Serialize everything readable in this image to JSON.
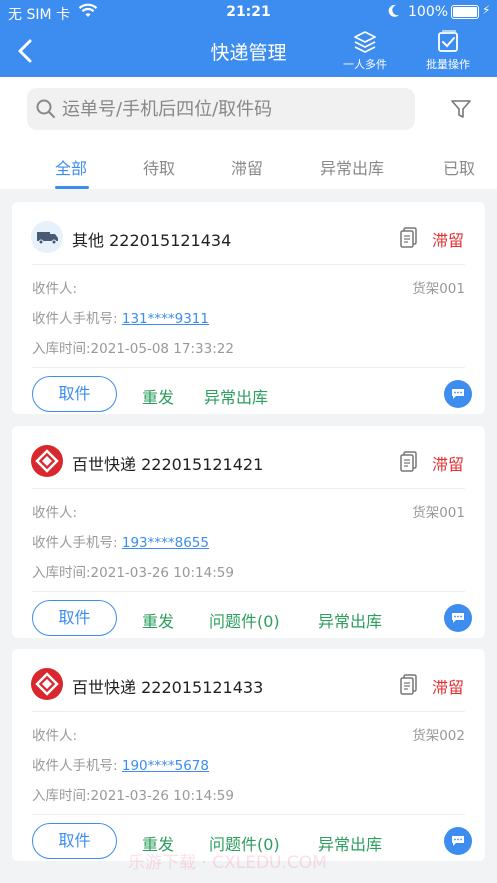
{
  "status_bar": {
    "carrier": "无 SIM 卡",
    "time": "21:21",
    "battery": "100%"
  },
  "header": {
    "title": "快递管理",
    "multi_label": "一人多件",
    "batch_label": "批量操作"
  },
  "search": {
    "placeholder": "运单号/手机后四位/取件码"
  },
  "tabs": [
    {
      "label": "全部",
      "active": true
    },
    {
      "label": "待取"
    },
    {
      "label": "滞留"
    },
    {
      "label": "异常出库"
    },
    {
      "label": "已取"
    }
  ],
  "colors": {
    "accent": "#3d8cf0",
    "status_red": "#e03131",
    "action_green": "#2c9e5e"
  },
  "packages": [
    {
      "logo_icon": "truck-icon",
      "courier": "其他",
      "tracking": "222015121434",
      "status": "滞留",
      "recipient_label": "收件人:",
      "shelf": "货架001",
      "phone_label": "收件人手机号:",
      "phone": "131****9311",
      "time": "入库时间:2021-05-08 17:33:22",
      "pickup": "取件",
      "resend": "重发",
      "abnormal": "异常出库"
    },
    {
      "logo_icon": "baishi-logo-icon",
      "courier": "百世快递",
      "tracking": "222015121421",
      "status": "滞留",
      "recipient_label": "收件人:",
      "shelf": "货架001",
      "phone_label": "收件人手机号:",
      "phone": "193****8655",
      "time": "入库时间:2021-03-26 10:14:59",
      "pickup": "取件",
      "resend": "重发",
      "problem": "问题件(0)",
      "abnormal": "异常出库"
    },
    {
      "logo_icon": "baishi-logo-icon",
      "courier": "百世快递",
      "tracking": "222015121433",
      "status": "滞留",
      "recipient_label": "收件人:",
      "shelf": "货架002",
      "phone_label": "收件人手机号:",
      "phone": "190****5678",
      "time": "入库时间:2021-03-26 10:14:59",
      "pickup": "取件",
      "resend": "重发",
      "problem": "问题件(0)",
      "abnormal": "异常出库"
    }
  ],
  "watermark": "乐游下载 · CXLEDU.COM"
}
